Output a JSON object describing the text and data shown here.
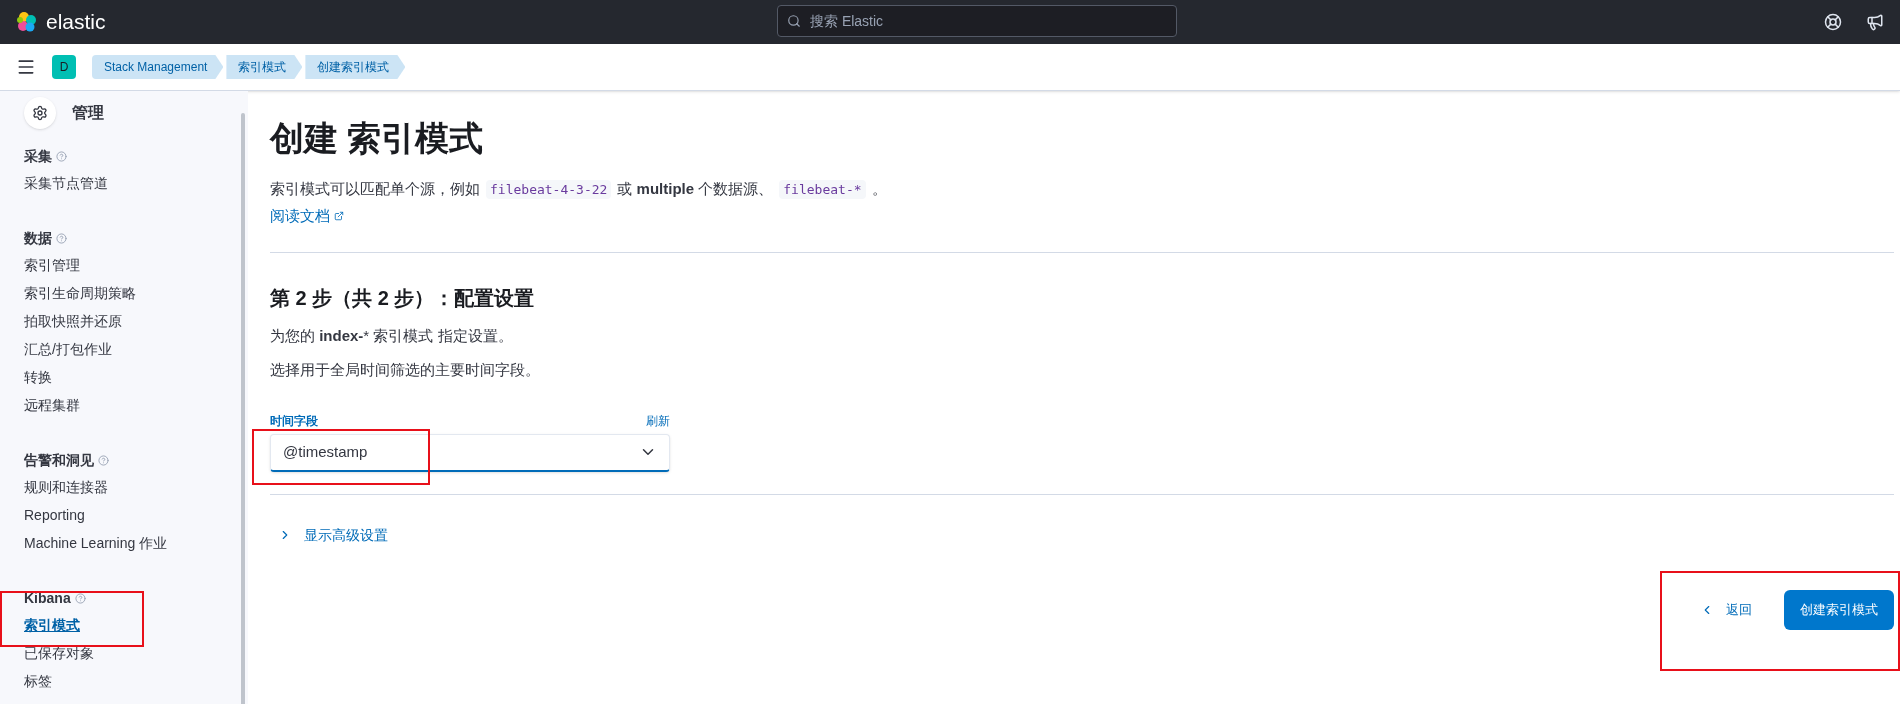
{
  "header": {
    "logo_text": "elastic",
    "search": {
      "placeholder": "搜索 Elastic"
    }
  },
  "breadcrumb_bar": {
    "space_letter": "D",
    "crumbs": [
      {
        "label": "Stack Management"
      },
      {
        "label": "索引模式"
      },
      {
        "label": "创建索引模式"
      }
    ]
  },
  "sidebar": {
    "title": "管理",
    "sections": [
      {
        "title": "采集",
        "items": [
          {
            "label": "采集节点管道",
            "selected": false
          }
        ]
      },
      {
        "title": "数据",
        "items": [
          {
            "label": "索引管理",
            "selected": false
          },
          {
            "label": "索引生命周期策略",
            "selected": false
          },
          {
            "label": "拍取快照并还原",
            "selected": false
          },
          {
            "label": "汇总/打包作业",
            "selected": false
          },
          {
            "label": "转换",
            "selected": false
          },
          {
            "label": "远程集群",
            "selected": false
          }
        ]
      },
      {
        "title": "告警和洞见",
        "items": [
          {
            "label": "规则和连接器",
            "selected": false
          },
          {
            "label": "Reporting",
            "selected": false
          },
          {
            "label": "Machine Learning 作业",
            "selected": false
          }
        ]
      },
      {
        "title": "Kibana",
        "items": [
          {
            "label": "索引模式",
            "selected": true
          },
          {
            "label": "已保存对象",
            "selected": false
          },
          {
            "label": "标签",
            "selected": false
          }
        ]
      }
    ]
  },
  "main": {
    "title": "创建 索引模式",
    "description": [
      {
        "kind": "text",
        "text": "索引模式可以匹配单个源，例如"
      },
      {
        "kind": "code",
        "text": "filebeat-4-3-22"
      },
      {
        "kind": "text",
        "text": "或 **multiple** 个数据源、"
      },
      {
        "kind": "code",
        "text": "filebeat-*"
      },
      {
        "kind": "text",
        "text": "。"
      }
    ],
    "docs_link": "阅读文档",
    "step_title": "第 2 步（共 2 步）：配置设置",
    "step_description": "为您的 **index-*** 索引模式 指定设置。",
    "time_hint": "选择用于全局时间筛选的主要时间字段。",
    "time_field": {
      "label": "时间字段",
      "refresh": "刷新",
      "value": "@timestamp"
    },
    "advanced_toggle": {
      "label": "显示高级设置",
      "expanded": false
    },
    "buttons": {
      "back": "返回",
      "create": "创建索引模式"
    }
  }
}
